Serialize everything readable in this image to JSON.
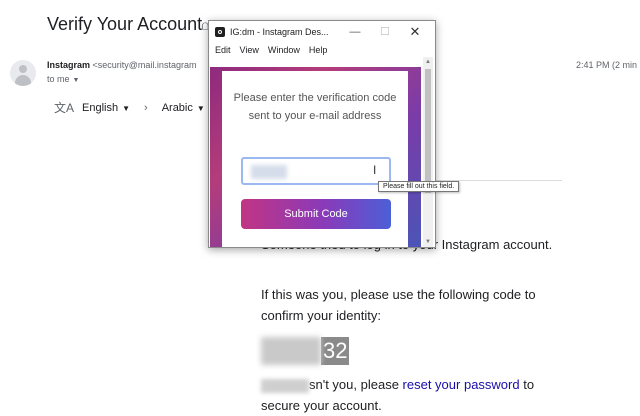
{
  "email": {
    "subject": "Verify Your Account",
    "sender_name": "Instagram",
    "sender_address": "<security@mail.instagram",
    "recipient": "to me",
    "time": "2:41 PM (2 min",
    "translate": {
      "from_language": "English",
      "to_language": "Arabic"
    },
    "body": {
      "line1": "Someone tried to log in to your Instagram account.",
      "line2": "If this was you, please use the following code to confirm your identity:",
      "code_visible": "32",
      "line3_prefix": "sn't you, please ",
      "reset_link": "reset your password",
      "line3_suffix": " to",
      "line4": "secure your account."
    }
  },
  "popup": {
    "title": "IG:dm - Instagram Des...",
    "menu": [
      "Edit",
      "View",
      "Window",
      "Help"
    ],
    "prompt": "Please enter the verification code sent to your e-mail address",
    "submit_label": "Submit Code",
    "tooltip": "Please fill out this field."
  },
  "icons": {
    "subject": "label-icon",
    "translate": "translate-icon",
    "avatar": "person-icon"
  },
  "colors": {
    "button_gradient_start": "#c13584",
    "button_gradient_end": "#4c5fd7",
    "link": "#1a0dab"
  }
}
